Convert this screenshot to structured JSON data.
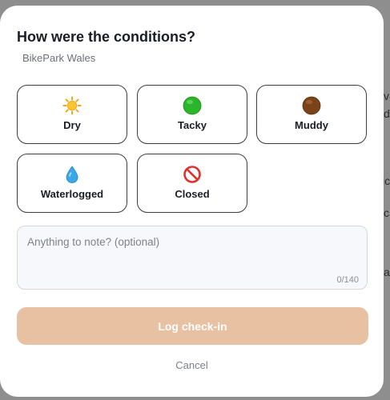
{
  "background": {
    "fragments": [
      "v",
      "d",
      "ic",
      "c",
      "a"
    ]
  },
  "modal": {
    "title": "How were the conditions?",
    "subtitle": "BikePark Wales",
    "options": [
      {
        "label": "Dry",
        "icon": "sun-icon"
      },
      {
        "label": "Tacky",
        "icon": "green-circle-icon"
      },
      {
        "label": "Muddy",
        "icon": "brown-circle-icon"
      },
      {
        "label": "Waterlogged",
        "icon": "droplet-icon"
      },
      {
        "label": "Closed",
        "icon": "prohibited-icon"
      }
    ],
    "note": {
      "placeholder": "Anything to note? (optional)",
      "counter": "0/140"
    },
    "submit_label": "Log check-in",
    "cancel_label": "Cancel"
  },
  "colors": {
    "accent_disabled": "#e8c0a2",
    "overlay": "#8e8e8e"
  }
}
